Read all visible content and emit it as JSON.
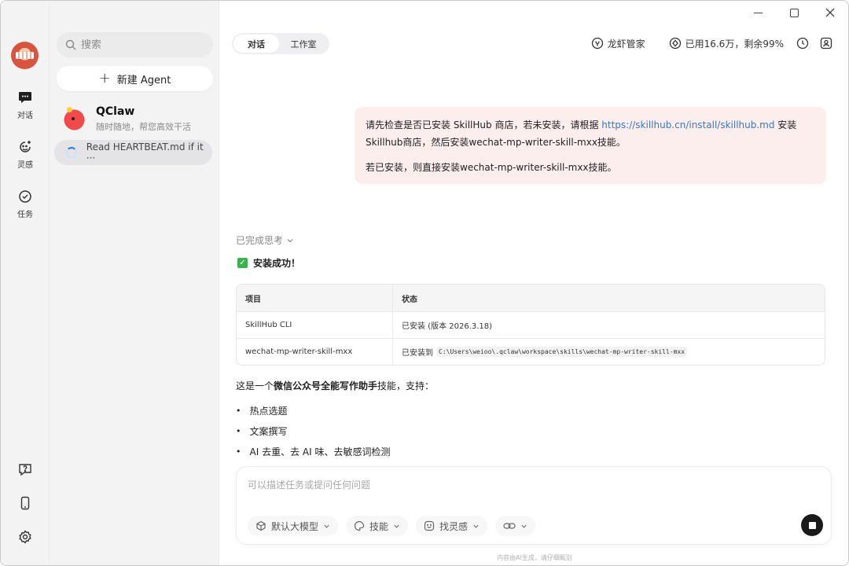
{
  "rail": {
    "items": [
      {
        "label": "对话"
      },
      {
        "label": "灵感"
      },
      {
        "label": "任务"
      }
    ]
  },
  "sidebar": {
    "search_placeholder": "搜索",
    "new_agent_label": "新建 Agent",
    "agent": {
      "name": "QClaw",
      "subtitle": "随时随地，帮您高效干活"
    },
    "task": {
      "label": "Read HEARTBEAT.md if it ···"
    }
  },
  "header": {
    "tabs": [
      {
        "label": "对话"
      },
      {
        "label": "工作室"
      }
    ],
    "manager_label": "龙虾管家",
    "usage_label": "已用16.6万，剩余99%"
  },
  "conversation": {
    "user_message": {
      "line1_before": "请先检查是否已安装 SkillHub 商店，若未安装，请根据 ",
      "link": "https://skillhub.cn/install/skillhub.md",
      "line1_after": " 安装Skillhub商店，然后安装wechat-mp-writer-skill-mxx技能。",
      "line2": "若已安装，则直接安装wechat-mp-writer-skill-mxx技能。"
    },
    "thinking_label": "已完成思考",
    "success_text": "安装成功！",
    "table": {
      "headers": [
        "项目",
        "状态"
      ],
      "rows": [
        {
          "item": "SkillHub CLI",
          "status": "已安装 (版本 2026.3.18)",
          "path": ""
        },
        {
          "item": "wechat-mp-writer-skill-mxx",
          "status": "已安装到",
          "path": "C:\\Users\\weioo\\.qclaw\\workspace\\skills\\wechat-mp-writer-skill-mxx"
        }
      ]
    },
    "description": {
      "prefix": "这是一个",
      "bold": "微信公众号全能写作助手",
      "suffix": "技能，支持："
    },
    "bullets": [
      "热点选题",
      "文案撰写",
      "AI 去重、去 AI 味、去敏感词检测"
    ]
  },
  "composer": {
    "placeholder": "可以描述任务或提问任何问题",
    "model_label": "默认大模型",
    "skills_label": "技能",
    "inspiration_label": "找灵感"
  },
  "footer_note": "内容由AI生成，请仔细甄别",
  "colors": {
    "accent_link": "#3a76c4",
    "user_bubble": "#fdeeee",
    "success_green": "#37b24d",
    "spinner_blue": "#2f7cf0"
  }
}
